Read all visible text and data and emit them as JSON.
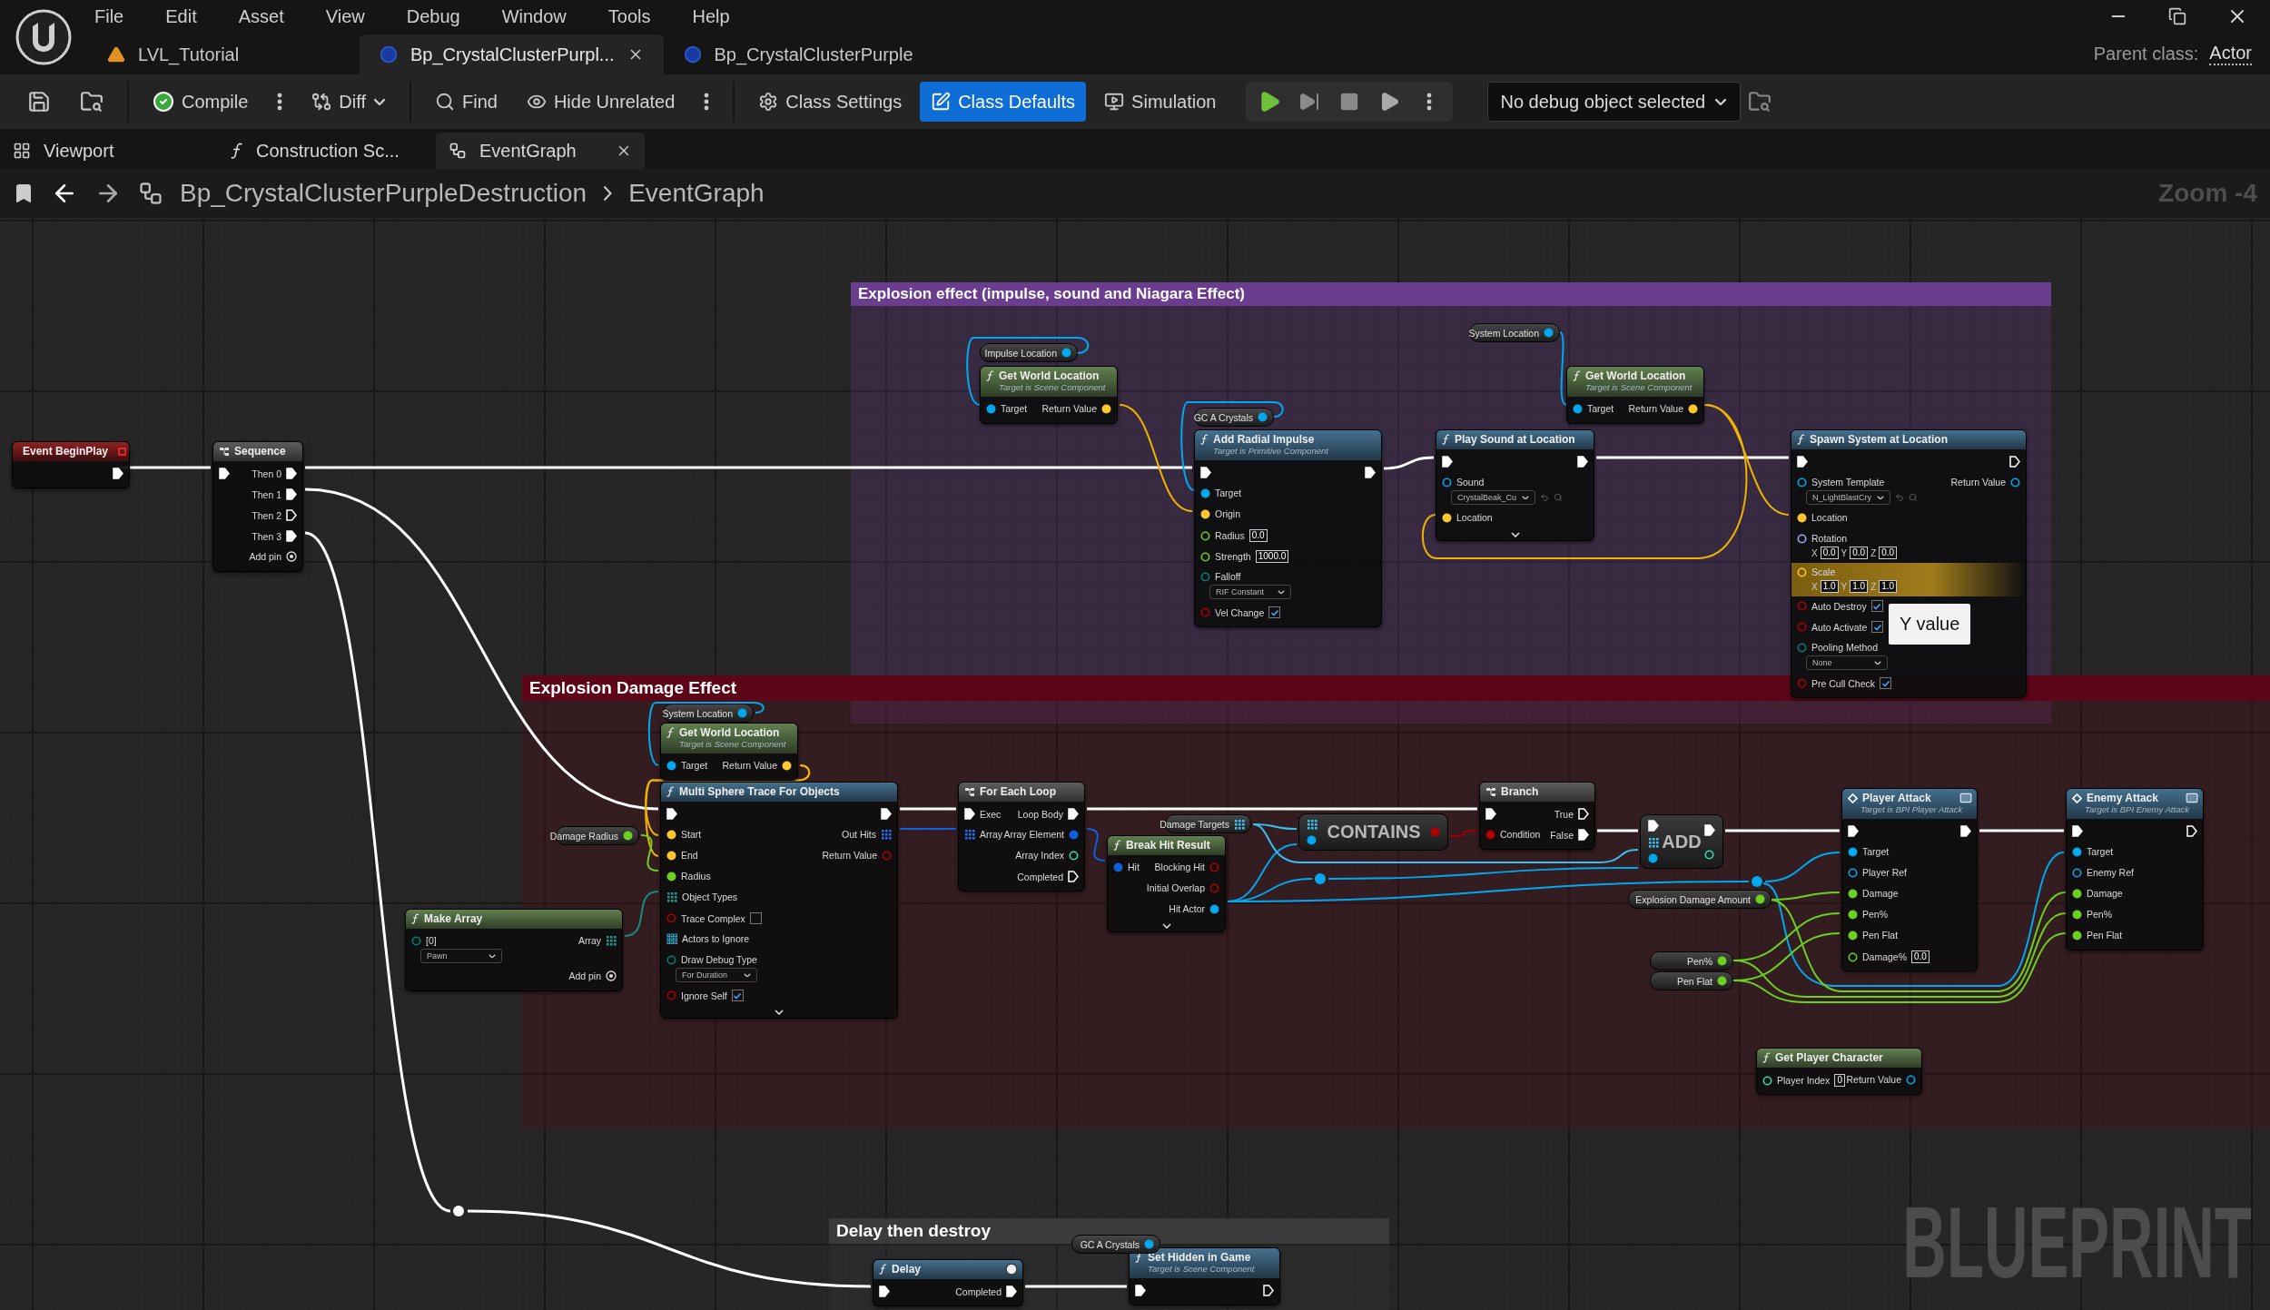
{
  "menu": [
    "File",
    "Edit",
    "Asset",
    "View",
    "Debug",
    "Window",
    "Tools",
    "Help"
  ],
  "document_tabs": [
    {
      "label": "LVL_Tutorial",
      "kind": "level",
      "selected": false
    },
    {
      "label": "Bp_CrystalClusterPurpl...",
      "kind": "blueprint",
      "selected": true
    },
    {
      "label": "Bp_CrystalClusterPurple",
      "kind": "blueprint",
      "selected": false
    }
  ],
  "parent_class": {
    "label": "Parent class:",
    "value": "Actor"
  },
  "toolbar": [
    {
      "kind": "save",
      "selected": false
    },
    {
      "kind": "browse",
      "selected": false
    },
    {
      "kind": "compile",
      "label": "Compile",
      "selected": false
    },
    {
      "kind": "more",
      "selected": false
    },
    {
      "kind": "diff",
      "label": "Diff",
      "selected": false
    },
    {
      "kind": "find",
      "label": "Find",
      "selected": false
    },
    {
      "kind": "hide",
      "label": "Hide Unrelated",
      "selected": false
    },
    {
      "kind": "more",
      "selected": false
    },
    {
      "kind": "settings",
      "label": "Class Settings",
      "selected": false
    },
    {
      "kind": "defaults",
      "label": "Class Defaults",
      "selected": true
    },
    {
      "kind": "simulation",
      "label": "Simulation",
      "selected": false
    }
  ],
  "debug_object": "No debug object selected",
  "graph_tabs": [
    {
      "label": "Viewport",
      "kind": "viewport",
      "selected": false
    },
    {
      "label": "Construction Sc...",
      "kind": "function",
      "selected": false
    },
    {
      "label": "EventGraph",
      "kind": "graph",
      "selected": true
    }
  ],
  "breadcrumb": [
    "Bp_CrystalClusterPurpleDestruction",
    "EventGraph"
  ],
  "zoom_label": "Zoom -4",
  "comments": [
    {
      "title": "Explosion effect (impulse, sound and Niagara Effect)",
      "color": "#6b3d8e"
    },
    {
      "title": "Explosion Damage Effect",
      "color": "#5c0618"
    },
    {
      "title": "Delay then destroy",
      "color": "#3b3b3b"
    }
  ],
  "nodes": [
    {
      "kind": "event",
      "title": "Event BeginPlay",
      "rows": [
        {
          "out": {
            "kind": "exec",
            "connected": true
          }
        }
      ]
    },
    {
      "kind": "macro",
      "title": "Sequence",
      "rows": [
        {
          "in": {
            "kind": "exec",
            "connected": true
          },
          "out": {
            "kind": "exec",
            "label": "Then 0",
            "connected": true
          }
        },
        {
          "out": {
            "kind": "exec",
            "label": "Then 1",
            "connected": true
          }
        },
        {
          "out": {
            "kind": "exec",
            "label": "Then 2",
            "connected": false
          }
        },
        {
          "out": {
            "kind": "exec",
            "label": "Then 3",
            "connected": true
          }
        },
        {
          "out": {
            "kind": "add",
            "label": "Add pin"
          }
        }
      ]
    },
    {
      "kind": "variable",
      "title": "Impulse Location",
      "pin": {
        "kind": "object",
        "connected": true
      }
    },
    {
      "kind": "pure",
      "title": "Get World Location",
      "subtitle": "Target is Scene Component",
      "rows": [
        {
          "in": {
            "kind": "object",
            "label": "Target",
            "connected": true
          },
          "out": {
            "kind": "vector",
            "label": "Return Value",
            "connected": true
          }
        }
      ]
    },
    {
      "kind": "variable",
      "title": "GC A Crystals",
      "pin": {
        "kind": "object",
        "connected": true
      }
    },
    {
      "kind": "function",
      "title": "Add Radial Impulse",
      "subtitle": "Target is Primitive Component",
      "rows": [
        {
          "in": {
            "kind": "exec",
            "connected": true
          },
          "out": {
            "kind": "exec",
            "connected": true
          }
        },
        {
          "in": {
            "kind": "object",
            "label": "Target",
            "connected": true
          }
        },
        {
          "in": {
            "kind": "vector",
            "label": "Origin",
            "connected": true
          }
        },
        {
          "in": {
            "kind": "float",
            "label": "Radius",
            "connected": false,
            "value": "0.0"
          }
        },
        {
          "in": {
            "kind": "float",
            "label": "Strength",
            "connected": false,
            "value": "1000.0"
          }
        },
        {
          "in": {
            "kind": "enum",
            "label": "Falloff",
            "connected": false,
            "stacked": true,
            "dropdown": "RIF Constant"
          }
        },
        {
          "in": {
            "kind": "bool",
            "label": "Vel Change",
            "connected": false,
            "checked": true
          }
        }
      ]
    },
    {
      "kind": "variable",
      "title": "System Location",
      "pin": {
        "kind": "object",
        "connected": true
      }
    },
    {
      "kind": "pure",
      "title": "Get World Location",
      "subtitle": "Target is Scene Component",
      "rows": [
        {
          "in": {
            "kind": "object",
            "label": "Target",
            "connected": true
          },
          "out": {
            "kind": "vector",
            "label": "Return Value",
            "connected": true
          }
        }
      ]
    },
    {
      "kind": "function",
      "title": "Play Sound at Location",
      "expandable": true,
      "rows": [
        {
          "in": {
            "kind": "exec",
            "connected": true
          },
          "out": {
            "kind": "exec",
            "connected": true
          }
        },
        {
          "in": {
            "kind": "object",
            "label": "Sound",
            "connected": false,
            "stacked": true,
            "dropdown": "CrystalBeak_Cu"
          }
        },
        {
          "in": {
            "kind": "vector",
            "label": "Location",
            "connected": true
          }
        }
      ]
    },
    {
      "kind": "function",
      "title": "Spawn System at Location",
      "rows": [
        {
          "in": {
            "kind": "exec",
            "connected": true
          },
          "out": {
            "kind": "exec",
            "connected": false
          }
        },
        {
          "in": {
            "kind": "object",
            "label": "System Template",
            "connected": false,
            "stacked": true,
            "dropdown": "N_LightBlastCry"
          },
          "out": {
            "kind": "object",
            "label": "Return Value",
            "connected": false
          }
        },
        {
          "in": {
            "kind": "vector",
            "label": "Location",
            "connected": true
          }
        },
        {
          "in": {
            "kind": "rotator",
            "label": "Rotation",
            "connected": false,
            "stacked": true,
            "vector": [
              {
                "axis": "X",
                "value": "0.0"
              },
              {
                "axis": "Y",
                "value": "0.0"
              },
              {
                "axis": "Z",
                "value": "0.0"
              }
            ]
          }
        },
        {
          "highlighted": true,
          "in": {
            "kind": "vector",
            "label": "Scale",
            "connected": false,
            "stacked": true,
            "vector": [
              {
                "axis": "X",
                "value": "1.0"
              },
              {
                "axis": "Y",
                "value": "1.0"
              },
              {
                "axis": "Z",
                "value": "1.0"
              }
            ]
          }
        },
        {
          "in": {
            "kind": "bool",
            "label": "Auto Destroy",
            "connected": false,
            "checked": true
          }
        },
        {
          "in": {
            "kind": "bool",
            "label": "Auto Activate",
            "connected": false,
            "checked": true
          }
        },
        {
          "in": {
            "kind": "enum",
            "label": "Pooling Method",
            "connected": false,
            "stacked": true,
            "dropdown": "None"
          }
        },
        {
          "in": {
            "kind": "bool",
            "label": "Pre Cull Check",
            "connected": false,
            "checked": true
          }
        }
      ]
    },
    {
      "kind": "variable",
      "title": "System Location",
      "pin": {
        "kind": "object",
        "connected": true
      }
    },
    {
      "kind": "pure",
      "title": "Get World Location",
      "subtitle": "Target is Scene Component",
      "rows": [
        {
          "in": {
            "kind": "object",
            "label": "Target",
            "connected": true
          },
          "out": {
            "kind": "vector",
            "label": "Return Value",
            "connected": true
          }
        }
      ]
    },
    {
      "kind": "function",
      "title": "Multi Sphere Trace For Objects",
      "expandable": true,
      "rows": [
        {
          "in": {
            "kind": "exec",
            "connected": true
          },
          "out": {
            "kind": "exec",
            "connected": true
          }
        },
        {
          "in": {
            "kind": "vector",
            "label": "Start",
            "connected": true
          },
          "out": {
            "kind": "struct_array",
            "label": "Out Hits",
            "connected": true
          }
        },
        {
          "in": {
            "kind": "vector",
            "label": "End",
            "connected": true
          },
          "out": {
            "kind": "bool",
            "label": "Return Value",
            "connected": false
          }
        },
        {
          "in": {
            "kind": "float",
            "label": "Radius",
            "connected": true
          }
        },
        {
          "in": {
            "kind": "enum_array",
            "label": "Object Types",
            "connected": true
          }
        },
        {
          "in": {
            "kind": "bool",
            "label": "Trace Complex",
            "connected": false,
            "checked": false
          }
        },
        {
          "in": {
            "kind": "object_array",
            "label": "Actors to Ignore",
            "connected": false
          }
        },
        {
          "in": {
            "kind": "enum",
            "label": "Draw Debug Type",
            "connected": false,
            "stacked": true,
            "dropdown": "For Duration"
          }
        },
        {
          "in": {
            "kind": "bool",
            "label": "Ignore Self",
            "connected": false,
            "checked": true
          }
        }
      ]
    },
    {
      "kind": "variable",
      "title": "Damage Radius",
      "pin": {
        "kind": "float",
        "connected": true
      }
    },
    {
      "kind": "pure",
      "title": "Make Array",
      "rows": [
        {
          "in": {
            "kind": "enum",
            "label": "[0]",
            "connected": false,
            "stacked": true,
            "dropdown": "Pawn"
          },
          "out": {
            "kind": "enum_array",
            "label": "Array",
            "connected": true
          }
        },
        {
          "out": {
            "kind": "add",
            "label": "Add pin"
          }
        }
      ]
    },
    {
      "kind": "macro",
      "title": "For Each Loop",
      "rows": [
        {
          "in": {
            "kind": "exec",
            "label": "Exec",
            "connected": true
          },
          "out": {
            "kind": "exec",
            "label": "Loop Body",
            "connected": true
          }
        },
        {
          "in": {
            "kind": "struct_array",
            "label": "Array",
            "connected": true
          },
          "out": {
            "kind": "struct",
            "label": "Array Element",
            "connected": true
          }
        },
        {
          "out": {
            "kind": "int",
            "label": "Array Index",
            "connected": false
          }
        },
        {
          "out": {
            "kind": "exec",
            "label": "Completed",
            "connected": false
          }
        }
      ]
    },
    {
      "kind": "variable",
      "title": "Damage Targets",
      "pin": {
        "kind": "object_array",
        "connected": true
      }
    },
    {
      "kind": "pure",
      "title": "Break Hit Result",
      "expandable": true,
      "rows": [
        {
          "in": {
            "kind": "struct",
            "label": "Hit",
            "connected": true
          },
          "out": {
            "kind": "bool",
            "label": "Blocking Hit",
            "connected": false
          }
        },
        {
          "out": {
            "kind": "bool",
            "label": "Initial Overlap",
            "connected": false
          }
        },
        {
          "out": {
            "kind": "object",
            "label": "Hit Actor",
            "connected": true
          }
        }
      ]
    },
    {
      "kind": "compact",
      "title": "CONTAINS",
      "rows": [
        {
          "in": {
            "kind": "object_array",
            "connected": true
          },
          "out": {
            "kind": "bool",
            "connected": true
          }
        },
        {
          "in": {
            "kind": "object",
            "connected": true
          }
        }
      ]
    },
    {
      "kind": "macro",
      "title": "Branch",
      "rows": [
        {
          "in": {
            "kind": "exec",
            "connected": true
          },
          "out": {
            "kind": "exec",
            "label": "True",
            "connected": false
          }
        },
        {
          "in": {
            "kind": "bool",
            "label": "Condition",
            "connected": true
          },
          "out": {
            "kind": "exec",
            "label": "False",
            "connected": true
          }
        }
      ]
    },
    {
      "kind": "compact",
      "title": "ADD",
      "rows": [
        {
          "in": {
            "kind": "exec",
            "connected": true
          },
          "out": {
            "kind": "exec",
            "connected": true
          }
        },
        {
          "in": {
            "kind": "object_array",
            "connected": true
          },
          "out": {
            "kind": "int",
            "connected": false
          }
        },
        {
          "in": {
            "kind": "object",
            "connected": true
          }
        }
      ]
    },
    {
      "kind": "variable",
      "title": "Explosion Damage Amount",
      "pin": {
        "kind": "float",
        "connected": true
      }
    },
    {
      "kind": "variable",
      "title": "Pen%",
      "pin": {
        "kind": "float",
        "connected": true
      }
    },
    {
      "kind": "variable",
      "title": "Pen Flat",
      "pin": {
        "kind": "float",
        "connected": true
      }
    },
    {
      "kind": "message",
      "title": "Player Attack",
      "subtitle": "Target is BPI Player Attack",
      "rows": [
        {
          "in": {
            "kind": "exec",
            "connected": true
          },
          "out": {
            "kind": "exec",
            "connected": true
          }
        },
        {
          "in": {
            "kind": "object",
            "label": "Target",
            "connected": true
          }
        },
        {
          "in": {
            "kind": "object",
            "label": "Player Ref",
            "connected": false
          }
        },
        {
          "in": {
            "kind": "float",
            "label": "Damage",
            "connected": true
          }
        },
        {
          "in": {
            "kind": "float",
            "label": "Pen%",
            "connected": true
          }
        },
        {
          "in": {
            "kind": "float",
            "label": "Pen Flat",
            "connected": true
          }
        },
        {
          "in": {
            "kind": "float",
            "label": "Damage%",
            "connected": false,
            "value": "0.0"
          }
        }
      ]
    },
    {
      "kind": "message",
      "title": "Enemy Attack",
      "subtitle": "Target is BPI Enemy Attack",
      "rows": [
        {
          "in": {
            "kind": "exec",
            "connected": true
          },
          "out": {
            "kind": "exec",
            "connected": false
          }
        },
        {
          "in": {
            "kind": "object",
            "label": "Target",
            "connected": true
          }
        },
        {
          "in": {
            "kind": "object",
            "label": "Enemy Ref",
            "connected": false
          }
        },
        {
          "in": {
            "kind": "float",
            "label": "Damage",
            "connected": true
          }
        },
        {
          "in": {
            "kind": "float",
            "label": "Pen%",
            "connected": true
          }
        },
        {
          "in": {
            "kind": "float",
            "label": "Pen Flat",
            "connected": true
          }
        }
      ]
    },
    {
      "kind": "pure",
      "title": "Get Player Character",
      "rows": [
        {
          "in": {
            "kind": "int",
            "label": "Player Index",
            "connected": false,
            "value": "0"
          },
          "out": {
            "kind": "object",
            "label": "Return Value",
            "connected": false
          }
        }
      ]
    },
    {
      "kind": "function",
      "title": "Delay",
      "latent": true,
      "rows": [
        {
          "in": {
            "kind": "exec",
            "connected": true
          },
          "out": {
            "kind": "exec",
            "label": "Completed",
            "connected": true
          }
        }
      ]
    },
    {
      "kind": "variable",
      "title": "GC A Crystals",
      "pin": {
        "kind": "object",
        "connected": true
      }
    },
    {
      "kind": "function",
      "title": "Set Hidden in Game",
      "subtitle": "Target is Scene Component",
      "rows": [
        {
          "in": {
            "kind": "exec",
            "connected": true
          },
          "out": {
            "kind": "exec",
            "connected": false
          }
        }
      ]
    }
  ],
  "tooltip": "Y value",
  "watermark": "BLUEPRINT"
}
